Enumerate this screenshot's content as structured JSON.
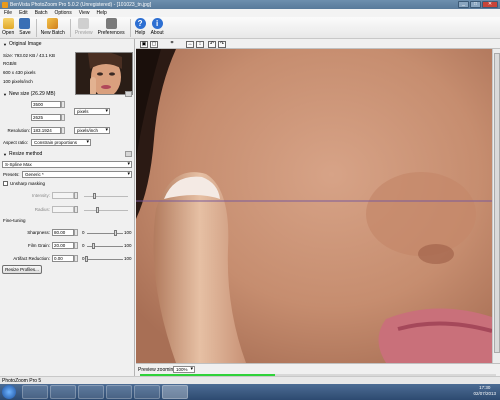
{
  "window": {
    "title": "BenVista PhotoZoom Pro 5.0.2 (Unregistered) - [101023_tn.jpg]",
    "controls": [
      "_",
      "□",
      "✕"
    ]
  },
  "menu": [
    "File",
    "Edit",
    "Batch",
    "Options",
    "View",
    "Help"
  ],
  "toolbar": {
    "open": "Open",
    "save": "Save",
    "new_batch": "New Batch",
    "preview": "Preview",
    "preferences": "Preferences",
    "help": "Help",
    "about": "About"
  },
  "original_image": {
    "header": "Original Image",
    "size": "Size: 793.02 KB / 43.1 KB",
    "color_mode": "RGB/8",
    "dimensions": "600 x 430 pixels",
    "resolution": "100 pixels/inch"
  },
  "new_size": {
    "header": "New size (26.29 MB)",
    "width_label": "Width:",
    "width_value": "3500",
    "height_label": "Height:",
    "height_value": "2625",
    "resolution_label": "Resolution:",
    "resolution_value": "183.1924",
    "unit": "pixels",
    "res_unit": "pixels/inch",
    "aspect_label": "Aspect ratio:",
    "aspect_value": "Constrain proportions"
  },
  "resize_method": {
    "header": "Resize method",
    "method": "S-Spline Max",
    "presets_label": "Presets:",
    "preset_value": "Generic *",
    "unsharp_label": "Unsharp masking",
    "intensity_label": "Intensity:",
    "radius_label": "Radius:",
    "fine_tuning_label": "Fine-tuning",
    "sharpness_label": "Sharpness:",
    "sharpness_value": "80.00",
    "film_grain_label": "Film Grain:",
    "film_grain_value": "20.00",
    "artifact_label": "Artifact Reduction:",
    "artifact_value": "0.00",
    "range_min": "0",
    "range_max": "100",
    "profiles_button": "Resize Profiles..."
  },
  "preview_zoom": {
    "label": "Preview zooming:",
    "value": "100%"
  },
  "status_text": "PhotoZoom Pro 5",
  "progress_fraction": 0.38,
  "taskbar": {
    "time": "17:30",
    "date": "02/07/2013"
  }
}
